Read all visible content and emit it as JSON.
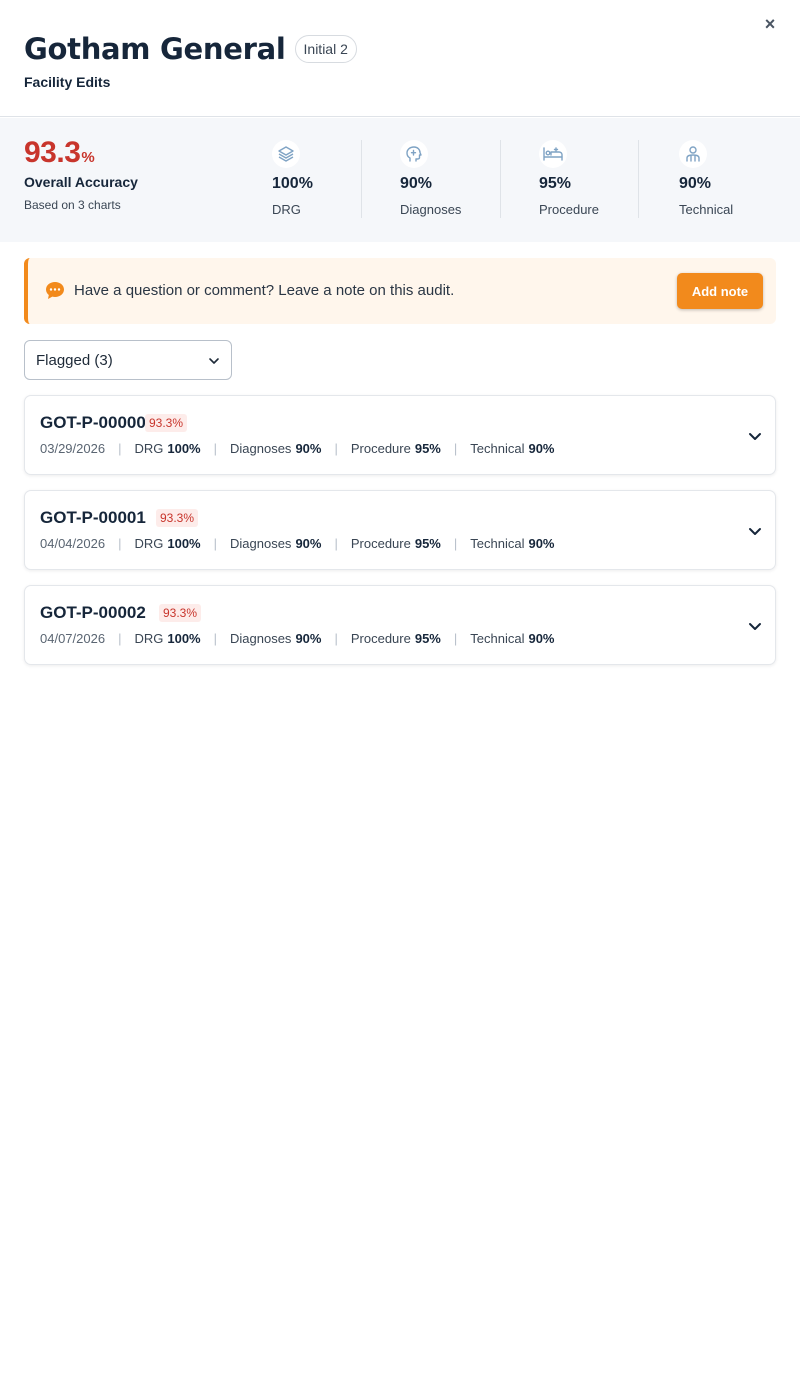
{
  "header": {
    "title": "Gotham General",
    "badge": "Initial 2",
    "subtitle": "Facility Edits",
    "close_label": "×"
  },
  "stats": {
    "overall_value": "93.3",
    "overall_unit": "%",
    "overall_label": "Overall Accuracy",
    "overall_sub": "Based on 3 charts",
    "metrics": [
      {
        "icon": "layers-icon",
        "value": "100%",
        "label": "DRG"
      },
      {
        "icon": "brain-icon",
        "value": "90%",
        "label": "Diagnoses"
      },
      {
        "icon": "bed-icon",
        "value": "95%",
        "label": "Procedure"
      },
      {
        "icon": "person-icon",
        "value": "90%",
        "label": "Technical"
      }
    ]
  },
  "note": {
    "icon": "chat-bubble-icon",
    "text": "Have a question or comment? Leave a note on this audit.",
    "button": "Add note"
  },
  "filter": {
    "selected": "Flagged (3)",
    "icon": "chevron-down-icon"
  },
  "cards": [
    {
      "id": "GOT-P-00000",
      "score": "93.3%",
      "date": "03/29/2026",
      "drg_label": "DRG",
      "drg": "100%",
      "diagnoses_label": "Diagnoses",
      "diagnoses": "90%",
      "procedure_label": "Procedure",
      "procedure": "95%",
      "technical_label": "Technical",
      "technical": "90%"
    },
    {
      "id": "GOT-P-00001",
      "score": "93.3%",
      "date": "04/04/2026",
      "drg_label": "DRG",
      "drg": "100%",
      "diagnoses_label": "Diagnoses",
      "diagnoses": "90%",
      "procedure_label": "Procedure",
      "procedure": "95%",
      "technical_label": "Technical",
      "technical": "90%"
    },
    {
      "id": "GOT-P-00002",
      "score": "93.3%",
      "date": "04/07/2026",
      "drg_label": "DRG",
      "drg": "100%",
      "diagnoses_label": "Diagnoses",
      "diagnoses": "90%",
      "procedure_label": "Procedure",
      "procedure": "95%",
      "technical_label": "Technical",
      "technical": "90%"
    }
  ],
  "colors": {
    "accent": "#f28a1c",
    "danger": "#c8352c",
    "text": "#16263a",
    "panel": "#f5f7fa",
    "note_bg": "#fff6ec"
  }
}
